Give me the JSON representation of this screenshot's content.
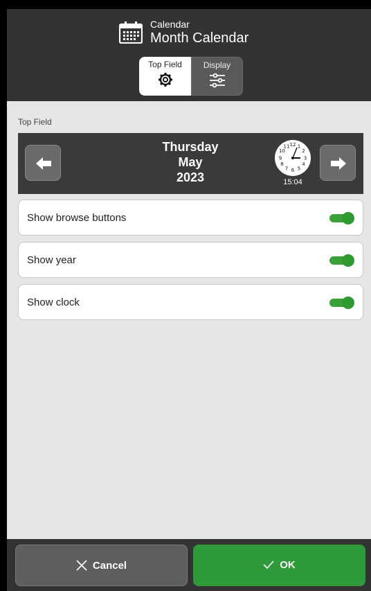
{
  "header": {
    "subtitle": "Calendar",
    "title": "Month Calendar",
    "tabs": [
      {
        "label": "Top Field",
        "icon": "gear-icon",
        "active": true
      },
      {
        "label": "Display",
        "icon": "sliders-icon",
        "active": false
      }
    ]
  },
  "section_label": "Top Field",
  "preview": {
    "weekday": "Thursday",
    "month": "May",
    "year": "2023",
    "clock_time": "15:04",
    "clock_numbers": [
      "12",
      "1",
      "2",
      "3",
      "4",
      "5",
      "6",
      "7",
      "8",
      "9",
      "10",
      "11"
    ]
  },
  "settings": [
    {
      "label": "Show browse buttons",
      "enabled": true
    },
    {
      "label": "Show year",
      "enabled": true
    },
    {
      "label": "Show clock",
      "enabled": true
    }
  ],
  "footer": {
    "cancel_label": "Cancel",
    "ok_label": "OK"
  },
  "colors": {
    "header_bg": "#333333",
    "accent_green": "#2f9a3a",
    "content_bg": "#e6e6e6"
  }
}
